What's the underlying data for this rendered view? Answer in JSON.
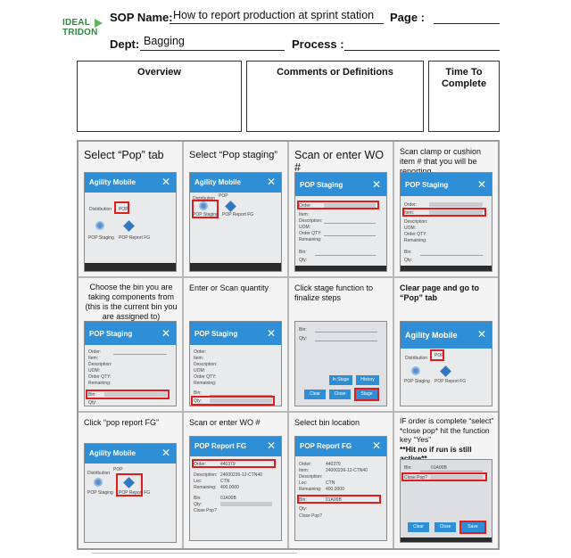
{
  "logo": {
    "line1": "IDEAL",
    "line2": "TRIDON"
  },
  "header": {
    "sop_name_label": "SOP Name:",
    "sop_name_value": "How to report production at sprint station",
    "page_label": "Page :",
    "dept_label": "Dept:",
    "dept_value": "Bagging",
    "process_label": "Process :"
  },
  "info_boxes": {
    "overview": "Overview",
    "comments": "Comments or Definitions",
    "time_line1": "Time To",
    "time_line2": "Complete"
  },
  "steps": [
    {
      "caption": "Select “Pop” tab"
    },
    {
      "caption": "Select “Pop staging”"
    },
    {
      "caption": "Scan or enter WO #"
    },
    {
      "caption": "Scan clamp or cushion item # that you will be reporting"
    },
    {
      "caption": "Choose the bin you are taking components from (this is the current bin you are assigned to)"
    },
    {
      "caption": "Enter or Scan quantity"
    },
    {
      "caption": "Click stage function to finalize steps"
    },
    {
      "caption": "Clear page and go to “Pop” tab"
    },
    {
      "caption": "Click “pop report FG”"
    },
    {
      "caption": "Scan or enter WO #"
    },
    {
      "caption": "Select bin location"
    },
    {
      "caption": "IF order is complete “select” *close pop* hit the function key “Yes”",
      "caption2": "**Hit no if run is still active**"
    }
  ],
  "screens": {
    "agility_title": "Agility Mobile",
    "staging_title": "POP Staging",
    "report_title": "POP Report FG",
    "close_glyph": "✕",
    "distribution": "Distribution",
    "pop": "POP",
    "pop_staging_icon_label": "POP Staging",
    "pop_report_icon_label": "POP Report FG",
    "order": "Order:",
    "item": "Item:",
    "description": "Description:",
    "uom": "UOM:",
    "order_qty": "Order QTY:",
    "remaining": "Remaining:",
    "bin": "Bin:",
    "qty": "Qty:",
    "loc": "Loc:",
    "close_pop": "Close Pop?",
    "btn_clear": "Clear",
    "btn_close": "Close",
    "btn_stage": "Stage",
    "btn_instage": "In Stage",
    "btn_history": "History",
    "btn_save": "Save",
    "order_value": "440379",
    "item_value": "24000236-12-CTN40",
    "uom_value": "CTN",
    "remaining_value": "400.0000",
    "bin_value": "01A00B"
  }
}
